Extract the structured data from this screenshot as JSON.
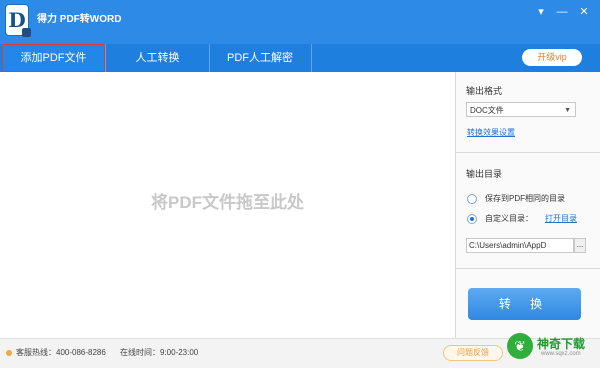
{
  "window": {
    "title": "得力 PDF转WORD",
    "logo_letter": "D",
    "controls": [
      "▾",
      "—",
      "✕"
    ]
  },
  "tabs": [
    {
      "label": "添加PDF文件",
      "active": true
    },
    {
      "label": "人工转换",
      "active": false
    },
    {
      "label": "PDF人工解密",
      "active": false
    }
  ],
  "vip_button": "开级vip",
  "dropzone": {
    "hint": "将PDF文件拖至此处"
  },
  "settings": {
    "format_label": "输出格式",
    "format_value": "DOC文件",
    "effect_link": "转换效果设置",
    "dir_label": "输出目录",
    "radio_same": "保存到PDF相同的目录",
    "radio_custom": "自定义目录：",
    "open_dir_link": "打开目录",
    "path_value": "C:\\Users\\admin\\AppD",
    "browse_label": "...",
    "convert_label": "转 换"
  },
  "status": {
    "hotline": "客服热线：400-086-8286",
    "hours": "在线时间：9:00-23:00",
    "ghost_button": "问题反馈"
  },
  "watermark": {
    "brand": "神奇下载",
    "url": "www.sqxz.com"
  },
  "colors": {
    "titlebar": "#2d8ae6",
    "tabbar": "#1f7fde",
    "accent": "#1f73d1",
    "vip": "#e47b2c"
  }
}
